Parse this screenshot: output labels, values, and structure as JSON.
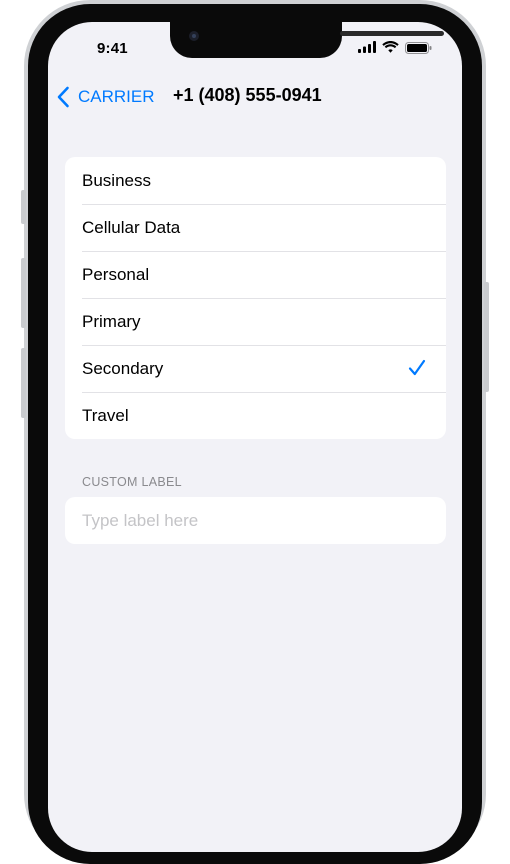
{
  "status_bar": {
    "time": "9:41",
    "icons": [
      "cellular-signal-icon",
      "wifi-icon",
      "battery-icon"
    ]
  },
  "nav": {
    "back_label": "CARRIER",
    "back_icon": "chevron-left-icon",
    "title": "+1 (408) 555-0941"
  },
  "labels": {
    "items": [
      {
        "label": "Business",
        "selected": false
      },
      {
        "label": "Cellular Data",
        "selected": false
      },
      {
        "label": "Personal",
        "selected": false
      },
      {
        "label": "Primary",
        "selected": false
      },
      {
        "label": "Secondary",
        "selected": true
      },
      {
        "label": "Travel",
        "selected": false
      }
    ],
    "check_icon": "checkmark-icon"
  },
  "custom_label": {
    "header": "CUSTOM LABEL",
    "value": "",
    "placeholder": "Type label here"
  },
  "colors": {
    "accent": "#007aff",
    "background": "#f2f2f7",
    "cell": "#ffffff",
    "secondary_text": "#8a8a8e",
    "placeholder": "#c4c4c7"
  }
}
